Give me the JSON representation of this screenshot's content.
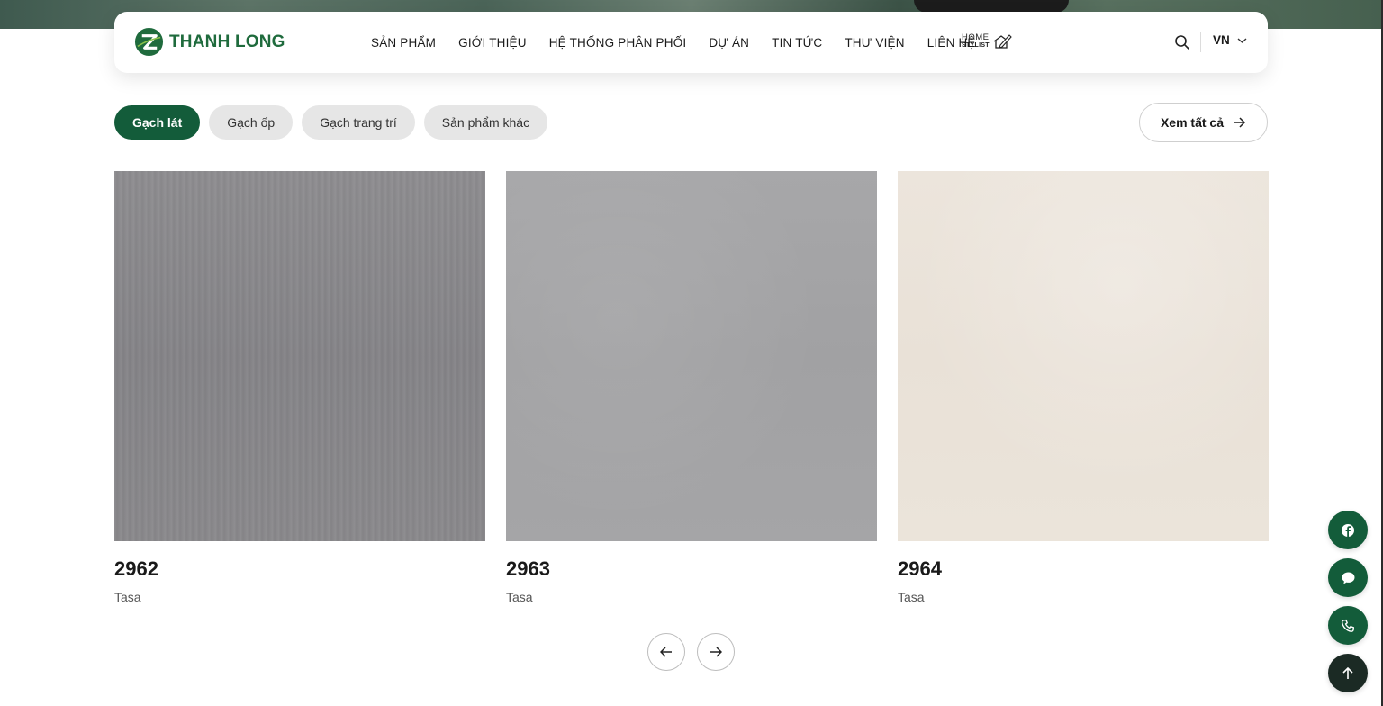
{
  "brand": {
    "name": "THANH LONG",
    "primary_color": "#135c3a",
    "logo_color": "#1f6b3d"
  },
  "nav": {
    "items": [
      "SẢN PHẨM",
      "GIỚI THIỆU",
      "HỆ THỐNG PHÂN PHỐI",
      "DỰ ÁN",
      "TIN TỨC",
      "THƯ VIỆN",
      "LIÊN HỆ"
    ],
    "home_stylist": {
      "line1": "HOME",
      "line2": "STYLIST"
    },
    "language": "VN"
  },
  "filters": {
    "tabs": [
      "Gạch lát",
      "Gạch ốp",
      "Gạch trang trí",
      "Sản phẩm khác"
    ],
    "active": "Gạch lát",
    "view_all": "Xem tất cả"
  },
  "products": [
    {
      "code": "2962",
      "brand": "Tasa",
      "swatch": "#89888b"
    },
    {
      "code": "2963",
      "brand": "Tasa",
      "swatch": "#a4a4a6"
    },
    {
      "code": "2964",
      "brand": "Tasa",
      "swatch": "#ebe3d9"
    }
  ],
  "icons": {
    "search": "search-icon",
    "lang_dropdown": "chevron-down-icon",
    "view_all": "arrow-right-icon",
    "prev": "arrow-left-icon",
    "next": "arrow-right-icon",
    "floating": [
      "facebook-icon",
      "chat-icon",
      "phone-icon",
      "arrow-up-icon"
    ]
  }
}
